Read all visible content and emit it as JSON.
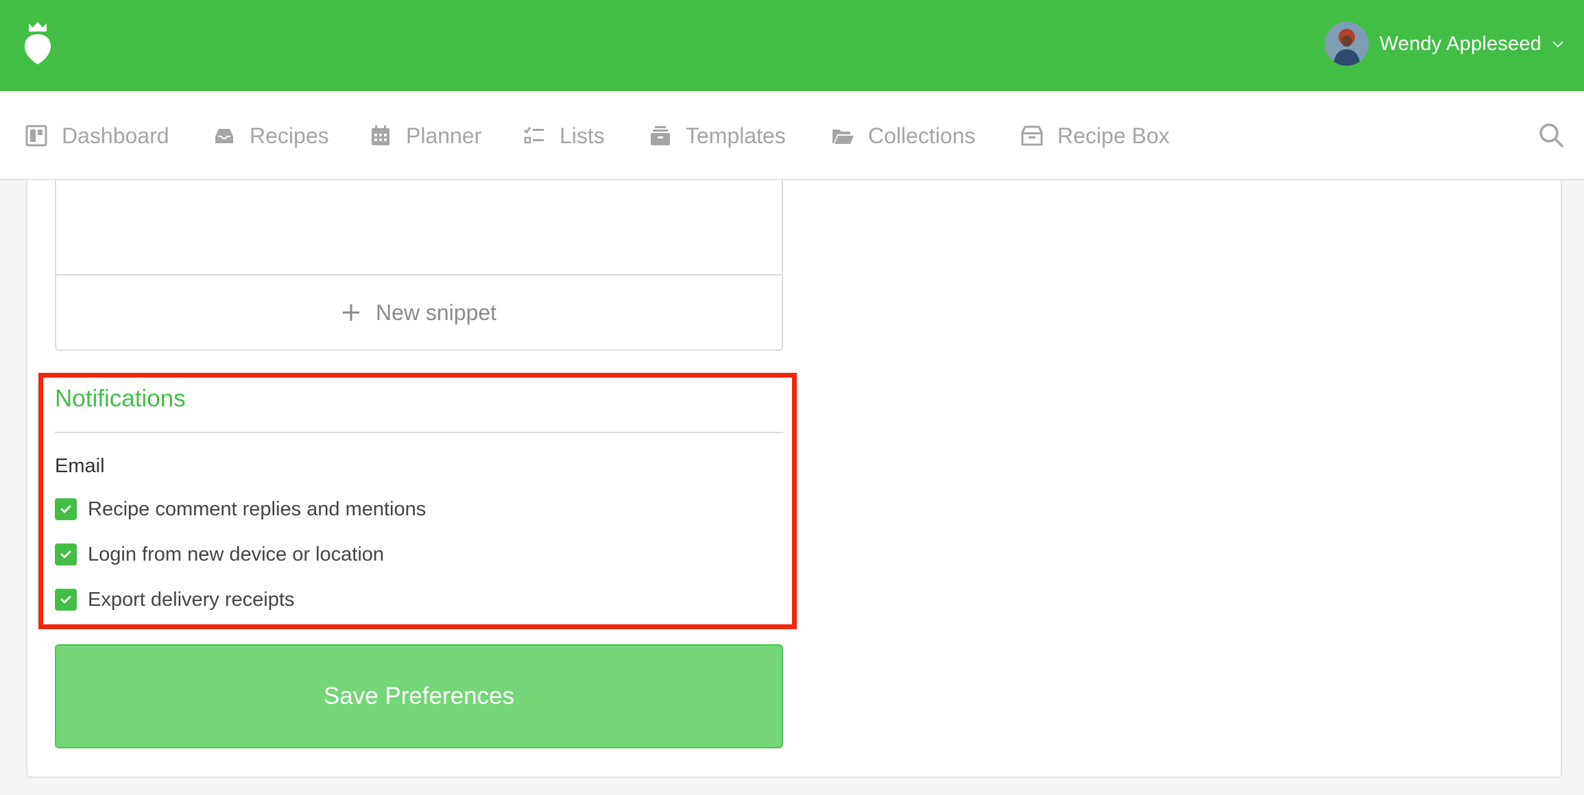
{
  "header": {
    "user_name": "Wendy Appleseed",
    "brand_color": "#43be45"
  },
  "nav": {
    "items": [
      {
        "label": "Dashboard",
        "icon": "dashboard-icon"
      },
      {
        "label": "Recipes",
        "icon": "inbox-icon"
      },
      {
        "label": "Planner",
        "icon": "calendar-icon"
      },
      {
        "label": "Lists",
        "icon": "checklist-icon"
      },
      {
        "label": "Templates",
        "icon": "stack-icon"
      },
      {
        "label": "Collections",
        "icon": "folder-open-icon"
      },
      {
        "label": "Recipe Box",
        "icon": "archive-box-icon"
      }
    ]
  },
  "snippets": {
    "new_label": "New snippet"
  },
  "notifications": {
    "title": "Notifications",
    "email_label": "Email",
    "options": [
      {
        "label": "Recipe comment replies and mentions",
        "checked": true
      },
      {
        "label": "Login from new device or location",
        "checked": true
      },
      {
        "label": "Export delivery receipts",
        "checked": true
      }
    ],
    "highlight_color": "#f3260e"
  },
  "actions": {
    "save_label": "Save Preferences"
  }
}
